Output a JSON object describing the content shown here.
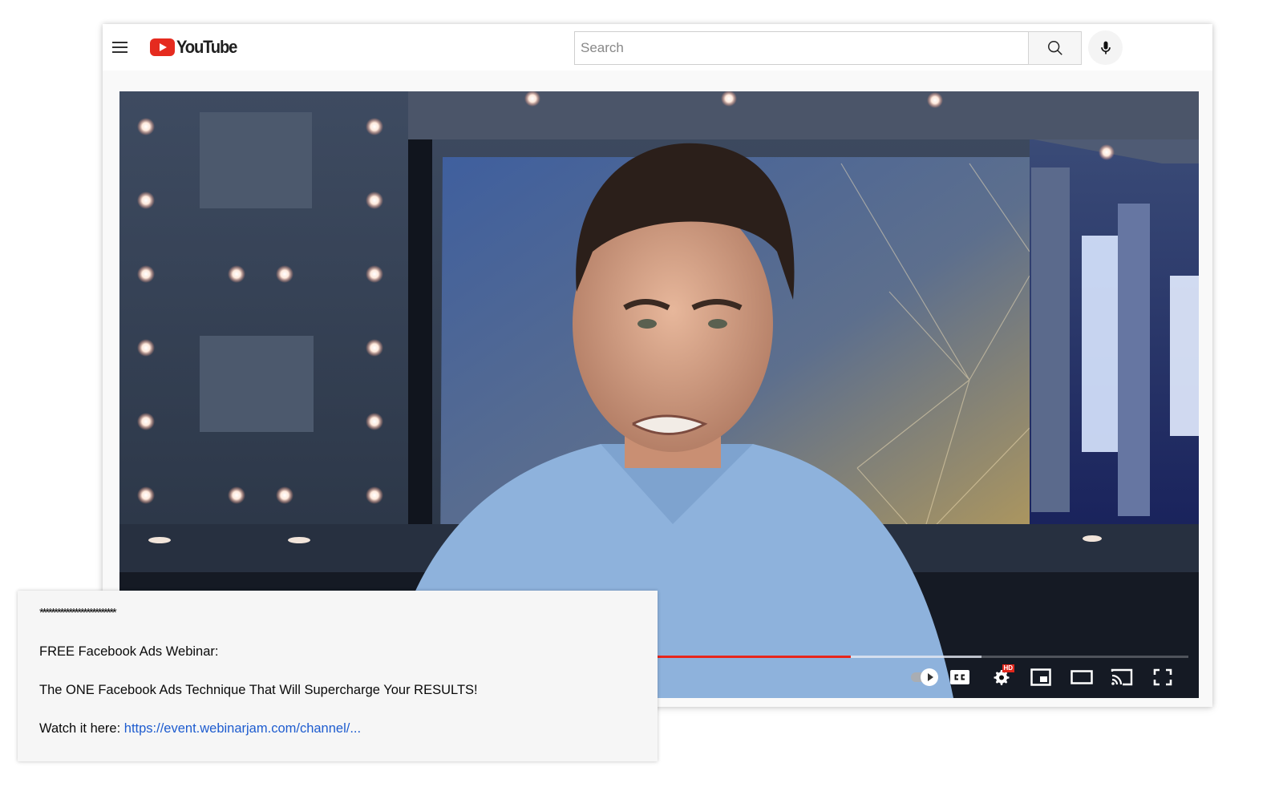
{
  "app": {
    "name": "YouTube",
    "brand_color": "#e52b1f"
  },
  "header": {
    "menu_icon": "hamburger-menu-icon",
    "logo_text": "YouTube",
    "search": {
      "placeholder": "Search",
      "value": ""
    },
    "search_button_icon": "search-icon",
    "voice_button_icon": "microphone-icon"
  },
  "player": {
    "progress": {
      "played_fraction": 0.681,
      "buffered_fraction": 0.805,
      "played_color": "#e8261c"
    },
    "controls": [
      {
        "name": "autoplay-toggle",
        "icon": "autoplay-toggle-icon",
        "state": "on"
      },
      {
        "name": "subtitles-button",
        "icon": "cc-icon",
        "label": "CC"
      },
      {
        "name": "settings-button",
        "icon": "gear-icon",
        "badge": "HD"
      },
      {
        "name": "miniplayer-button",
        "icon": "miniplayer-icon"
      },
      {
        "name": "theater-mode-button",
        "icon": "theater-mode-icon"
      },
      {
        "name": "cast-button",
        "icon": "cast-icon"
      },
      {
        "name": "fullscreen-button",
        "icon": "fullscreen-icon"
      }
    ]
  },
  "description": {
    "separator": "**************************",
    "heading": "FREE Facebook Ads Webinar:",
    "tagline": "The ONE Facebook Ads Technique That Will Supercharge Your RESULTS!",
    "cta_prefix": "Watch it here: ",
    "cta_link_text": "https://event.webinarjam.com/channel/...",
    "link_color": "#1e5ccf"
  }
}
